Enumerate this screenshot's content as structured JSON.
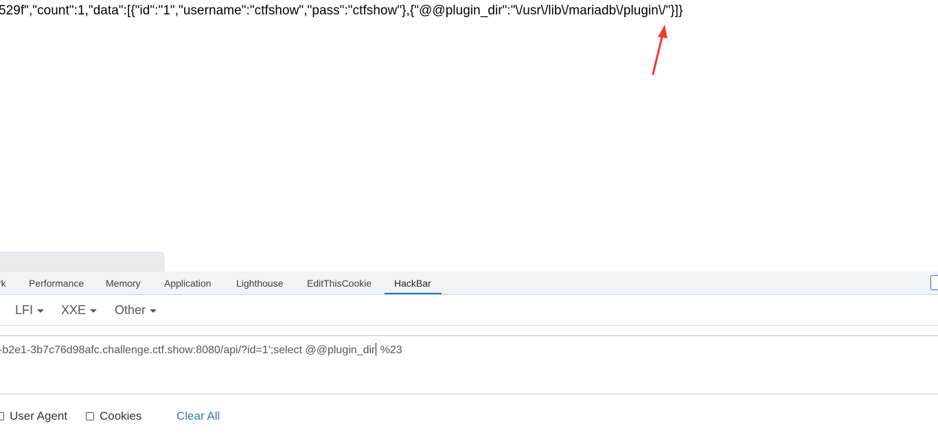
{
  "response": {
    "json_text": "529f\",\"count\":1,\"data\":[{\"id\":\"1\",\"username\":\"ctfshow\",\"pass\":\"ctfshow\"},{\"@@plugin_dir\":\"\\/usr\\/lib\\/mariadb\\/plugin\\/\"}]}"
  },
  "annotation": {
    "arrow_color": "#ee3b34"
  },
  "devtools": {
    "tabs": [
      {
        "label": "rk"
      },
      {
        "label": "Performance"
      },
      {
        "label": "Memory"
      },
      {
        "label": "Application"
      },
      {
        "label": "Lighthouse"
      },
      {
        "label": "EditThisCookie"
      },
      {
        "label": "HackBar"
      }
    ],
    "active_tab": "HackBar",
    "accent_color": "#1a73e8"
  },
  "hackbar": {
    "menus": [
      {
        "label": "LFI"
      },
      {
        "label": "XXE"
      },
      {
        "label": "Other"
      }
    ],
    "url_before_cursor": "-b2e1-3b7c76d98afc.challenge.ctf.show:8080/api/?id=1';select @@plugin_dir",
    "url_after_cursor": " %23",
    "options": {
      "user_agent_label": "User Agent",
      "cookies_label": "Cookies",
      "clear_all_label": "Clear All"
    }
  }
}
